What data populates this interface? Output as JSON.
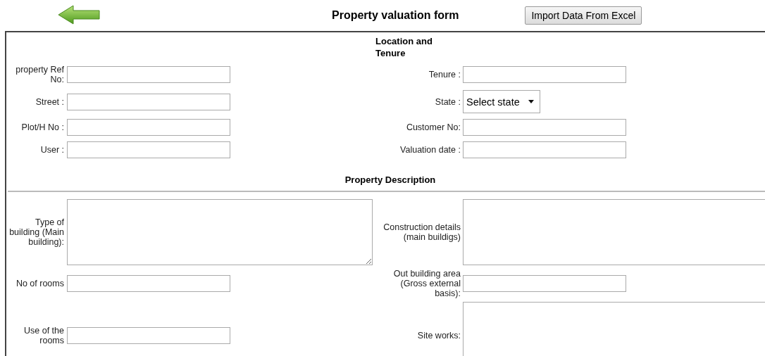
{
  "header": {
    "title": "Property valuation form",
    "import_button": "Import Data From Excel"
  },
  "sections": [
    {
      "title": "Location and Tenure",
      "kind": "compact",
      "rows": [
        {
          "left": {
            "label": "property Ref No:",
            "kind": "input"
          },
          "right": {
            "label": "Tenure :",
            "kind": "input"
          }
        },
        {
          "left": {
            "label": "Street :",
            "kind": "input"
          },
          "right": {
            "label": "State :",
            "kind": "select",
            "value": "Select state"
          }
        },
        {
          "left": {
            "label": "Plot/H No :",
            "kind": "input"
          },
          "right": {
            "label": "Customer No:",
            "kind": "input"
          }
        },
        {
          "left": {
            "label": "User :",
            "kind": "input"
          },
          "right": {
            "label": "Valuation date :",
            "kind": "input"
          }
        }
      ]
    },
    {
      "title": "Property Description",
      "kind": "ruled",
      "rows": [
        {
          "left": {
            "label": "Type of building (Main building):",
            "kind": "textarea"
          },
          "right": {
            "label": "Construction details (main buildigs)",
            "kind": "textarea"
          }
        },
        {
          "left": {
            "label": "No of rooms",
            "kind": "input"
          },
          "right": {
            "label": "Out building area (Gross external basis):",
            "kind": "input"
          }
        },
        {
          "left": {
            "label": "Use of the rooms",
            "kind": "input"
          },
          "right": {
            "label": "Site works:",
            "kind": "textarea"
          }
        }
      ]
    }
  ]
}
